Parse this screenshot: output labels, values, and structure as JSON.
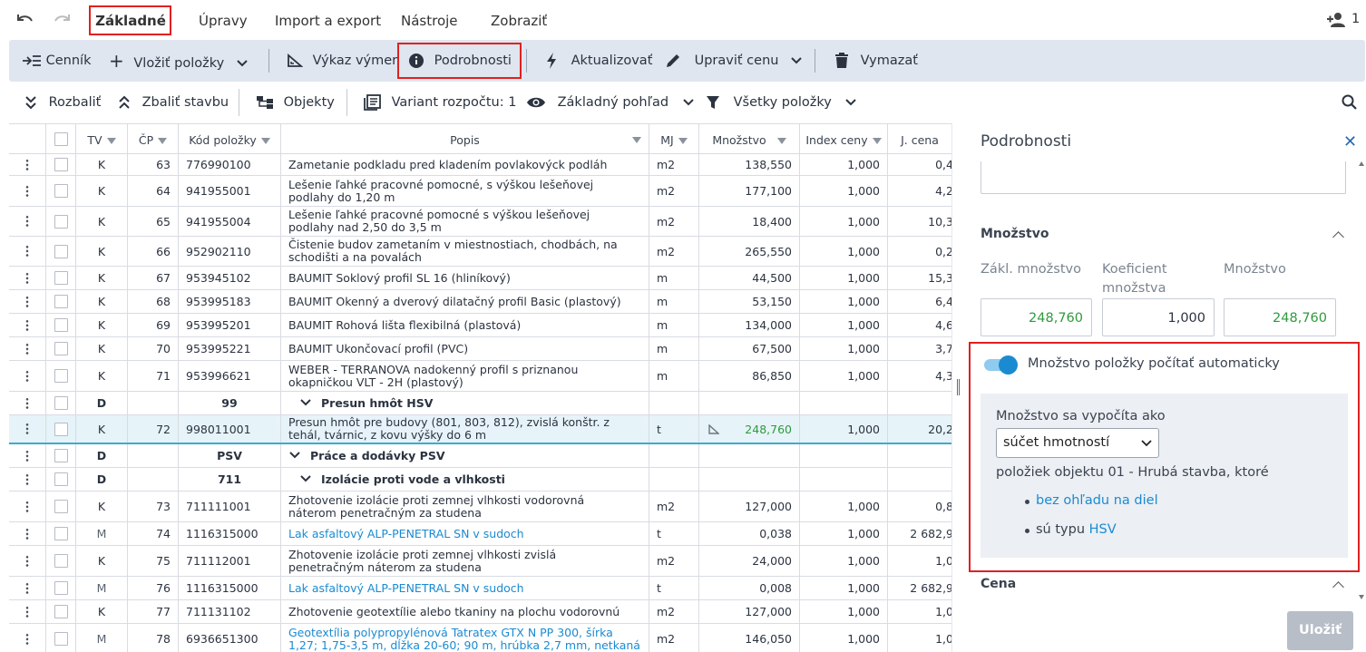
{
  "menu": {
    "tabs": [
      "Základné",
      "Úpravy",
      "Import a export",
      "Nástroje",
      "Zobraziť"
    ],
    "user_count": "1"
  },
  "toolbar1": {
    "cennik": "Cenník",
    "vlozit": "Vložiť položky",
    "vykaz": "Výkaz výmer",
    "podrobnosti": "Podrobnosti",
    "aktualizovat": "Aktualizovať",
    "upravit_cenu": "Upraviť cenu",
    "vymazat": "Vymazať"
  },
  "toolbar2": {
    "rozbalit": "Rozbaliť",
    "zbalit": "Zbaliť stavbu",
    "objekty": "Objekty",
    "variant": "Variant rozpočtu: 1",
    "pohlad": "Základný pohľad",
    "polozky": "Všetky položky"
  },
  "grid": {
    "headers": {
      "tv": "TV",
      "cp": "ČP",
      "kod": "Kód položky",
      "popis": "Popis",
      "mj": "MJ",
      "mnozstvo": "Množstvo",
      "index": "Index ceny",
      "jcena": "J. cena"
    },
    "rows": [
      {
        "tv": "K",
        "cp": "63",
        "kod": "776990100",
        "popis": [
          "Zametanie podkladu pred kladením povlakovýck podláh"
        ],
        "mj": "m2",
        "mnozstvo": "138,550",
        "index": "1,000",
        "jcena": "0,4"
      },
      {
        "tv": "K",
        "cp": "64",
        "kod": "941955001",
        "popis": [
          "Lešenie ľahké pracovné pomocné, s výškou lešeňovej",
          "podlahy do 1,20 m"
        ],
        "mj": "m2",
        "mnozstvo": "177,100",
        "index": "1,000",
        "jcena": "4,2"
      },
      {
        "tv": "K",
        "cp": "65",
        "kod": "941955004",
        "popis": [
          "Lešenie ľahké pracovné pomocné s výškou lešeňovej",
          "podlahy nad 2,50 do 3,5 m"
        ],
        "mj": "m2",
        "mnozstvo": "18,400",
        "index": "1,000",
        "jcena": "10,3"
      },
      {
        "tv": "K",
        "cp": "66",
        "kod": "952902110",
        "popis": [
          "Čistenie budov zametaním v miestnostiach, chodbách, na",
          "schodišti a na povalách"
        ],
        "mj": "m2",
        "mnozstvo": "265,550",
        "index": "1,000",
        "jcena": "0,2"
      },
      {
        "tv": "K",
        "cp": "67",
        "kod": "953945102",
        "popis": [
          "BAUMIT Soklový profil SL 16 (hliníkový)"
        ],
        "mj": "m",
        "mnozstvo": "44,500",
        "index": "1,000",
        "jcena": "15,3"
      },
      {
        "tv": "K",
        "cp": "68",
        "kod": "953995183",
        "popis": [
          "BAUMIT Okenný a dverový dilatačný profil Basic (plastový)"
        ],
        "mj": "m",
        "mnozstvo": "53,150",
        "index": "1,000",
        "jcena": "6,4"
      },
      {
        "tv": "K",
        "cp": "69",
        "kod": "953995201",
        "popis": [
          "BAUMIT Rohová lišta flexibilná (plastová)"
        ],
        "mj": "m",
        "mnozstvo": "134,000",
        "index": "1,000",
        "jcena": "4,6"
      },
      {
        "tv": "K",
        "cp": "70",
        "kod": "953995221",
        "popis": [
          "BAUMIT Ukončovací profil (PVC)"
        ],
        "mj": "m",
        "mnozstvo": "67,500",
        "index": "1,000",
        "jcena": "3,7"
      },
      {
        "tv": "K",
        "cp": "71",
        "kod": "953996621",
        "popis": [
          "WEBER - TERRANOVA nadokenný profil s priznanou",
          "okapničkou VLT - 2H (plastový)"
        ],
        "mj": "m",
        "mnozstvo": "86,850",
        "index": "1,000",
        "jcena": "4,3"
      },
      {
        "tv": "D",
        "cp": "",
        "kod": "99",
        "popis": [
          "Presun hmôt HSV"
        ],
        "mj": "",
        "mnozstvo": "",
        "index": "",
        "jcena": ""
      },
      {
        "tv": "K",
        "cp": "72",
        "kod": "998011001",
        "popis": [
          "Presun hmôt pre budovy (801, 803, 812), zvislá konštr. z",
          "tehál, tvárnic, z kovu výšky do 6 m"
        ],
        "mj": "t",
        "mnozstvo": "248,760",
        "index": "1,000",
        "jcena": "20,2"
      },
      {
        "tv": "D",
        "cp": "",
        "kod": "PSV",
        "popis": [
          "Práce a dodávky PSV"
        ],
        "mj": "",
        "mnozstvo": "",
        "index": "",
        "jcena": ""
      },
      {
        "tv": "D",
        "cp": "",
        "kod": "711",
        "popis": [
          "Izolácie proti vode a vlhkosti"
        ],
        "mj": "",
        "mnozstvo": "",
        "index": "",
        "jcena": ""
      },
      {
        "tv": "K",
        "cp": "73",
        "kod": "711111001",
        "popis": [
          "Zhotovenie izolácie proti zemnej vlhkosti vodorovná",
          "náterom penetračným za studena"
        ],
        "mj": "m2",
        "mnozstvo": "127,000",
        "index": "1,000",
        "jcena": "0,8"
      },
      {
        "tv": "M",
        "cp": "74",
        "kod": "1116315000",
        "popis": [
          "Lak asfaltový ALP-PENETRAL SN v sudoch"
        ],
        "mj": "t",
        "mnozstvo": "0,038",
        "index": "1,000",
        "jcena": "2 682,9"
      },
      {
        "tv": "K",
        "cp": "75",
        "kod": "711112001",
        "popis": [
          "Zhotovenie izolácie proti zemnej vlhkosti zvislá",
          "penetračným náterom za studena"
        ],
        "mj": "m2",
        "mnozstvo": "24,000",
        "index": "1,000",
        "jcena": "1,0"
      },
      {
        "tv": "M",
        "cp": "76",
        "kod": "1116315000",
        "popis": [
          "Lak asfaltový ALP-PENETRAL SN v sudoch"
        ],
        "mj": "t",
        "mnozstvo": "0,008",
        "index": "1,000",
        "jcena": "2 682,9"
      },
      {
        "tv": "K",
        "cp": "77",
        "kod": "711131102",
        "popis": [
          "Zhotovenie geotextílie alebo tkaniny na plochu vodorovnú"
        ],
        "mj": "m2",
        "mnozstvo": "127,000",
        "index": "1,000",
        "jcena": "1,0"
      },
      {
        "tv": "M",
        "cp": "78",
        "kod": "6936651300",
        "popis": [
          "Geotextília polypropylénová Tatratex GTX N PP 300, šírka",
          "1,27; 1,75-3,5 m, dĺžka 20-60; 90 m, hrúbka 2,7 mm, netkaná"
        ],
        "mj": "m2",
        "mnozstvo": "146,050",
        "index": "1,000",
        "jcena": "1,0"
      }
    ]
  },
  "panel": {
    "title": "Podrobnosti",
    "section_mnozstvo": "Množstvo",
    "label_zakl": "Zákl. množstvo",
    "label_koef_1": "Koeficient",
    "label_koef_2": "množstva",
    "label_mnozstvo": "Množstvo",
    "val_zakl": "248,760",
    "val_koef": "1,000",
    "val_mnozstvo": "248,760",
    "auto_label": "Množstvo položky počítať automaticky",
    "calc_label": "Množstvo sa vypočíta ako",
    "calc_option": "súčet hmotností",
    "objekt_text": "položiek objektu 01 - Hrubá stavba, ktoré",
    "bullet1_link": "bez ohľadu na diel",
    "bullet2_prefix": "sú typu ",
    "bullet2_link": "HSV",
    "section_cena": "Cena",
    "save": "Uložiť"
  },
  "colors": {
    "accent": "#1a8bd1",
    "highlight": "#e02020",
    "toolbar_bg": "#dfe6ef",
    "qty_green": "#2f9a3e",
    "save_disabled": "#b7bec7"
  }
}
